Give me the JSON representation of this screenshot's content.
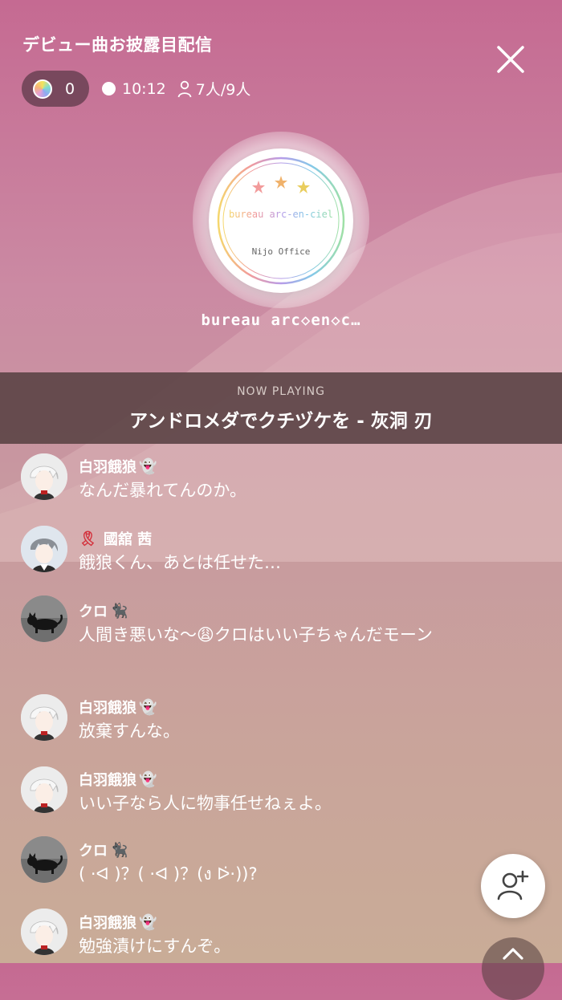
{
  "stream": {
    "title": "デビュー曲お披露目配信",
    "coins": "0",
    "elapsed": "10:12",
    "listeners": "7人/9人"
  },
  "channel": {
    "logo_top_text": "bureau arc-en-ciel",
    "logo_bottom_text": "Nijo Office",
    "name": "bureau arc◇en◇c…"
  },
  "now_playing": {
    "label": "NOW PLAYING",
    "track": "アンドロメダでクチヅケを - 灰洞 刃"
  },
  "colors": {
    "accent_ribbon": "#d4303b",
    "bar": "#5f4648"
  },
  "chat": [
    {
      "user": "白羽餓狼",
      "badge": "👻",
      "prefix": "",
      "text": "なんだ暴れてんのか。",
      "avatar": "white-hair-boy"
    },
    {
      "user": "國舘 茜",
      "badge": "",
      "prefix": "🎗",
      "text": "餓狼くん、あとは任せた…",
      "avatar": "gray-hair-boy"
    },
    {
      "user": "クロ",
      "badge": "🐈‍⬛",
      "prefix": "",
      "text": "人間き悪いな〜😩クロはいい子ちゃんだモーン",
      "avatar": "black-cat"
    },
    {
      "user": "白羽餓狼",
      "badge": "👻",
      "prefix": "",
      "text": "放棄すんな。",
      "avatar": "white-hair-boy"
    },
    {
      "user": "白羽餓狼",
      "badge": "👻",
      "prefix": "",
      "text": "いい子なら人に物事任せねぇよ。",
      "avatar": "white-hair-boy"
    },
    {
      "user": "クロ",
      "badge": "🐈‍⬛",
      "prefix": "",
      "text": "( ·ᐊ )？( ·ᐊ )？(ง ᐅ̇·))?",
      "avatar": "black-cat"
    },
    {
      "user": "白羽餓狼",
      "badge": "👻",
      "prefix": "",
      "text": "勉強漬けにすんぞ。",
      "avatar": "white-hair-boy"
    }
  ],
  "icons": {
    "close": "close-icon",
    "coin": "coin-icon",
    "person": "person-icon",
    "add_friend": "add-friend-icon",
    "share": "share-icon"
  }
}
